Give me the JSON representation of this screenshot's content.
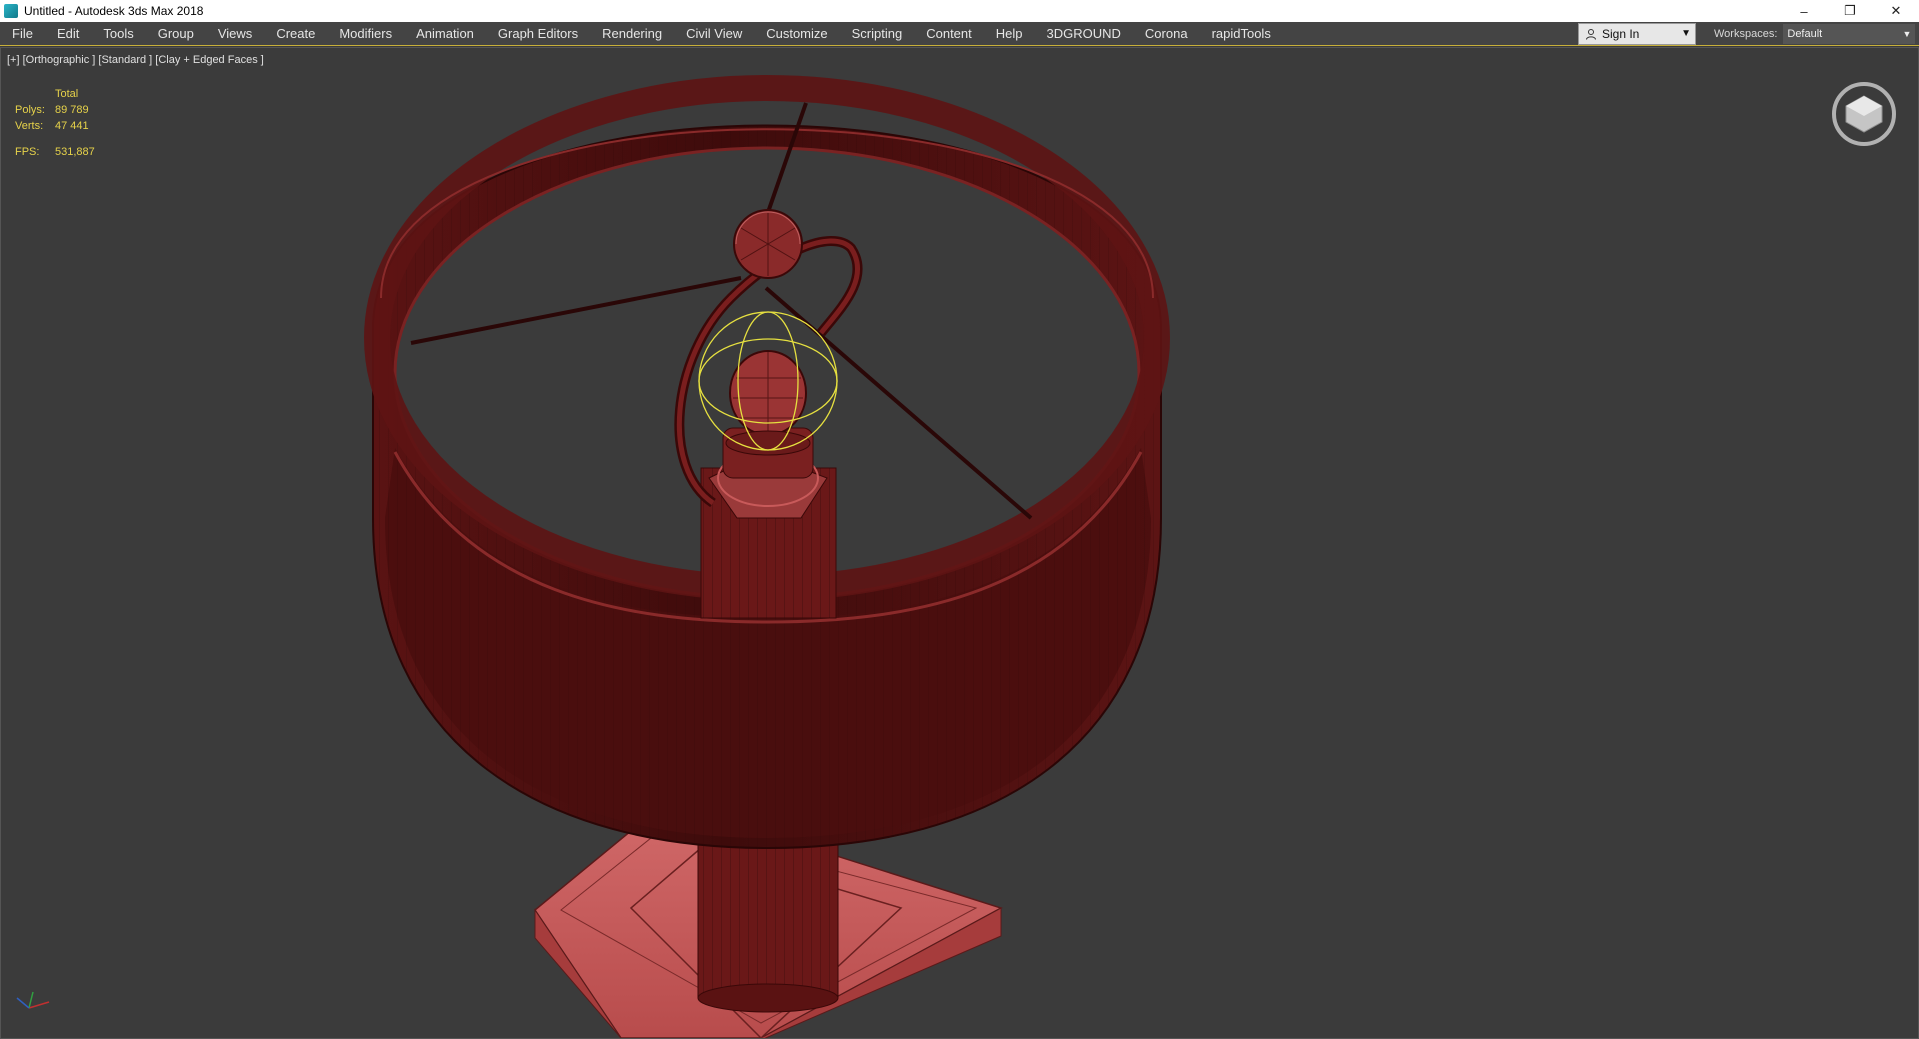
{
  "window": {
    "title": "Untitled - Autodesk 3ds Max 2018",
    "controls": [
      "minimize-icon",
      "restore-icon",
      "close-icon"
    ]
  },
  "menu": {
    "items": [
      "File",
      "Edit",
      "Tools",
      "Group",
      "Views",
      "Create",
      "Modifiers",
      "Animation",
      "Graph Editors",
      "Rendering",
      "Civil View",
      "Customize",
      "Scripting",
      "Content",
      "Help",
      "3DGROUND",
      "Corona",
      "rapidTools"
    ]
  },
  "account": {
    "sign_in": "Sign In"
  },
  "workspaces": {
    "label": "Workspaces:",
    "value": "Default"
  },
  "viewport": {
    "label": "[+] [Orthographic ] [Standard ] [Clay + Edged Faces ]",
    "stats": {
      "header": "Total",
      "polys_label": "Polys:",
      "polys_value": "89 789",
      "verts_label": "Verts:",
      "verts_value": "47 441",
      "fps_label": "FPS:",
      "fps_value": "531,887"
    }
  },
  "colors": {
    "model_dark": "#4a0f0f",
    "model_mid": "#6e1a1a",
    "model_light": "#c85a5a",
    "selection": "#e6e040",
    "viewport_bg": "#3b3b3b"
  }
}
